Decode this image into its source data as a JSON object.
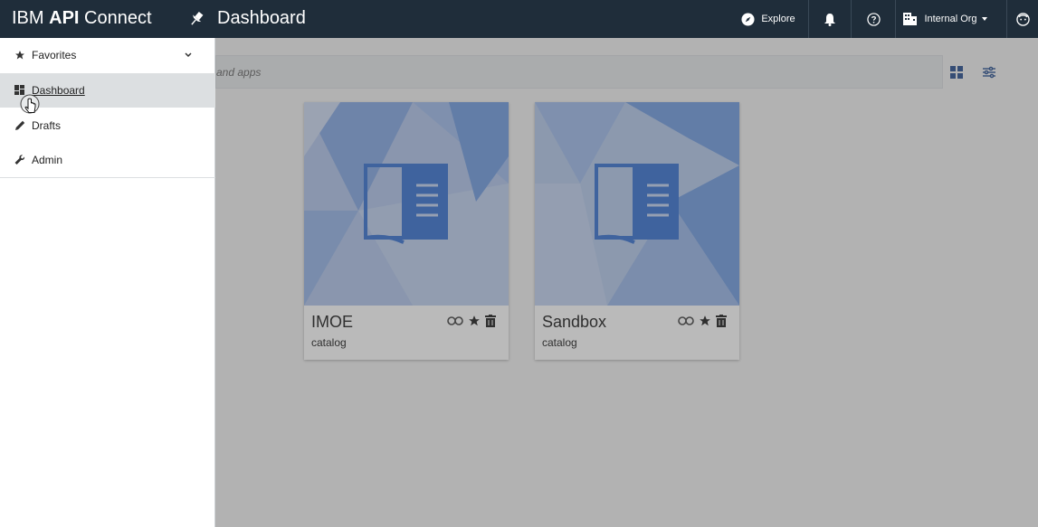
{
  "brand": {
    "prefix": "IBM ",
    "bold": "API",
    "suffix": " Connect"
  },
  "header": {
    "title": "Dashboard",
    "explore_label": "Explore",
    "org_label": "Internal Org"
  },
  "sidebar": {
    "items": [
      {
        "label": "Favorites",
        "icon": "star-icon"
      },
      {
        "label": "Dashboard",
        "icon": "dashboard-icon"
      },
      {
        "label": "Drafts",
        "icon": "pencil-icon"
      },
      {
        "label": "Admin",
        "icon": "wrench-icon"
      }
    ]
  },
  "search": {
    "placeholder": "and apps"
  },
  "cards": [
    {
      "title": "IMOE",
      "subtitle": "catalog"
    },
    {
      "title": "Sandbox",
      "subtitle": "catalog"
    }
  ],
  "colors": {
    "topbar": "#1f2d3a",
    "accent": "#4a7fd6",
    "selected": "#dcdfe1"
  }
}
